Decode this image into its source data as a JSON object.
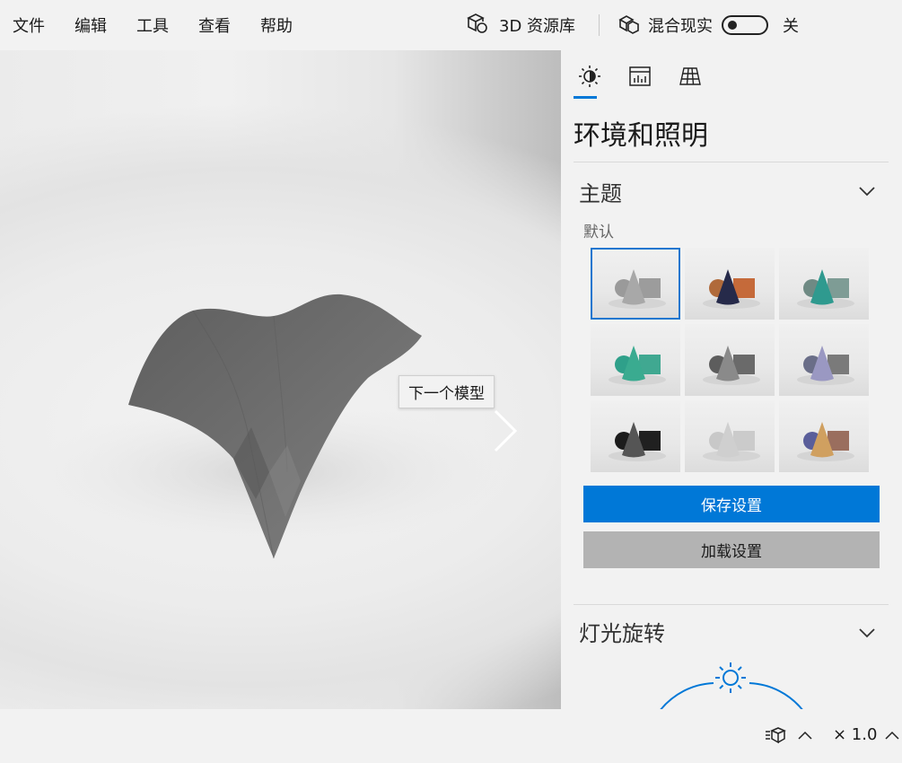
{
  "menu": {
    "items": [
      "文件",
      "编辑",
      "工具",
      "查看",
      "帮助"
    ],
    "library_label": "3D 资源库",
    "mixed_reality_label": "混合现实",
    "mixed_reality_state": "关"
  },
  "viewport": {
    "tooltip": "下一个模型"
  },
  "panel": {
    "tabs": [
      {
        "icon": "sun-moon-icon",
        "active": true
      },
      {
        "icon": "stats-chart-icon",
        "active": false
      },
      {
        "icon": "grid-icon",
        "active": false
      }
    ],
    "title": "环境和照明",
    "theme_section": {
      "title": "主题",
      "sublabel": "默认",
      "themes": [
        {
          "sphere": "#9a9a9a",
          "cone": "#a8a8a8",
          "box": "#9c9c9c",
          "selected": true
        },
        {
          "sphere": "#b06a3a",
          "cone": "#262a4a",
          "box": "#c56a3a",
          "selected": false
        },
        {
          "sphere": "#6f8a84",
          "cone": "#2f9a8f",
          "box": "#7e9c95",
          "selected": false
        },
        {
          "sphere": "#2fa08a",
          "cone": "#3aab90",
          "box": "#40a891",
          "selected": false
        },
        {
          "sphere": "#5d5d5d",
          "cone": "#8a8a8a",
          "box": "#6a6a6a",
          "selected": false
        },
        {
          "sphere": "#6a6e88",
          "cone": "#9a98c2",
          "box": "#7a7a7a",
          "selected": false
        },
        {
          "sphere": "#1c1c1c",
          "cone": "#555555",
          "box": "#202020",
          "selected": false
        },
        {
          "sphere": "#c8c8c8",
          "cone": "#cfcfcf",
          "box": "#cbcbcb",
          "selected": false
        },
        {
          "sphere": "#5a5e9a",
          "cone": "#d0a060",
          "box": "#9a6e5e",
          "selected": false
        }
      ]
    },
    "buttons": {
      "save": "保存设置",
      "load": "加载设置"
    },
    "light_section": {
      "title": "灯光旋转"
    }
  },
  "statusbar": {
    "speed_label": "× 1.0"
  },
  "colors": {
    "accent": "#0078d7",
    "background": "#f2f2f2",
    "model": "#6c6c6c"
  }
}
